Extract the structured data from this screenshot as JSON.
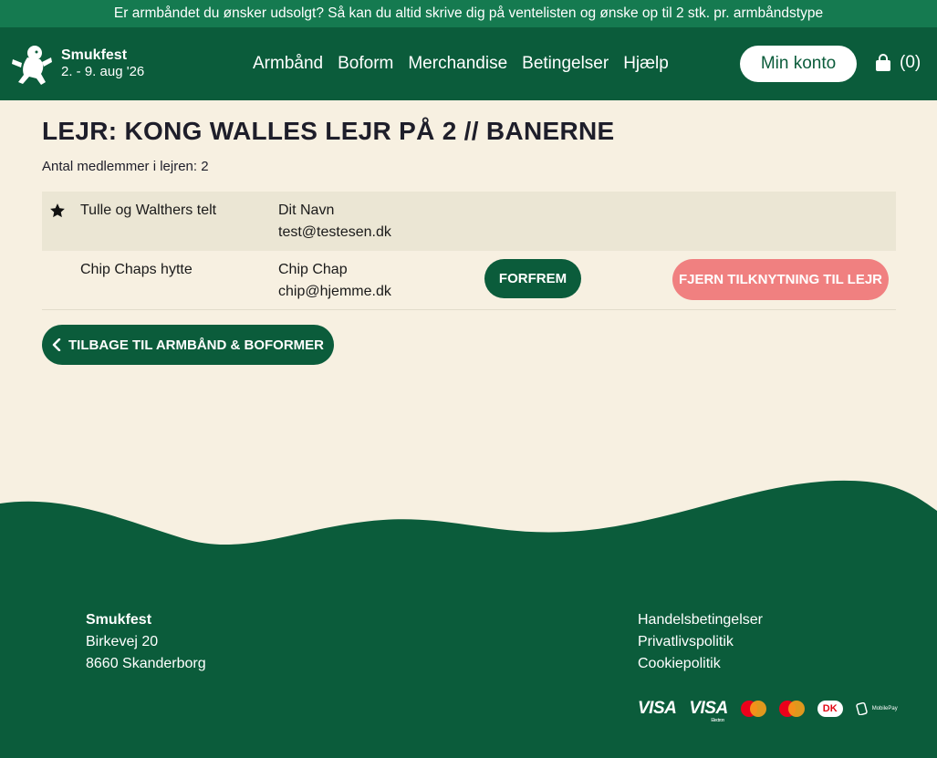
{
  "banner": {
    "text": "Er armbåndet du ønsker udsolgt? Så kan du altid skrive dig på ventelisten og ønske op til 2 stk. pr. armbåndstype"
  },
  "header": {
    "brand_name": "Smukfest",
    "brand_dates": "2. - 9. aug '26",
    "nav": [
      "Armbånd",
      "Boform",
      "Merchandise",
      "Betingelser",
      "Hjælp"
    ],
    "account_label": "Min konto",
    "cart_count": "(0)"
  },
  "main": {
    "title": "LEJR: KONG WALLES LEJR PÅ 2 // BANERNE",
    "member_count": "Antal medlemmer i lejren: 2",
    "members": [
      {
        "tent": "Tulle og Walthers telt",
        "name": "Dit Navn",
        "email": "test@testesen.dk",
        "leader": true
      },
      {
        "tent": "Chip Chaps hytte",
        "name": "Chip Chap",
        "email": "chip@hjemme.dk",
        "leader": false
      }
    ],
    "promote_label": "FORFREM",
    "remove_label": "FJERN TILKNYTNING TIL LEJR",
    "back_label": "TILBAGE TIL ARMBÅND & BOFORMER"
  },
  "footer": {
    "company": "Smukfest",
    "street": "Birkevej 20",
    "city": "8660 Skanderborg",
    "links": [
      "Handelsbetingelser",
      "Privatlivspolitik",
      "Cookiepolitik"
    ],
    "payments": {
      "visa": "VISA",
      "visa_electron": "VISA",
      "visa_electron_sub": "Electron",
      "dankort": "DK",
      "mobilepay": "MobilePay"
    }
  },
  "colors": {
    "primary": "#0b5c3b",
    "banner": "#157a50",
    "background": "#f7f0e1",
    "row_highlight": "#ebe6d4",
    "danger": "#f08080"
  },
  "icons": {
    "logo": "smukfest-mascot-logo",
    "cart": "shopping-bag-icon",
    "leader": "star-icon",
    "back": "chevron-left-icon"
  }
}
